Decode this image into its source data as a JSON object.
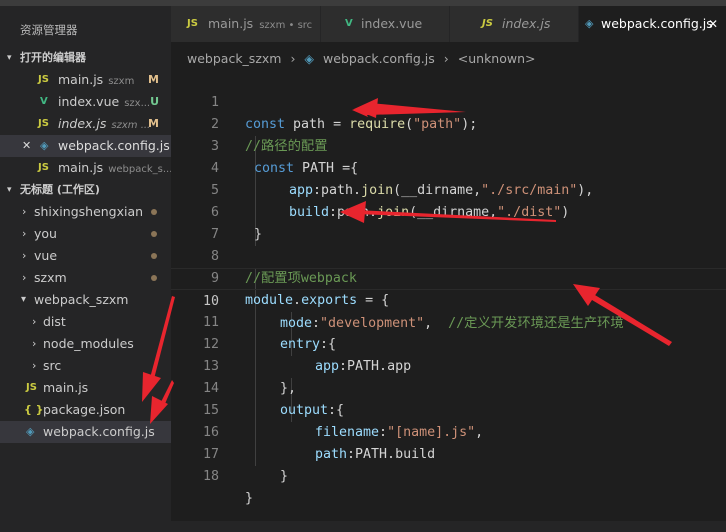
{
  "sidebar": {
    "title": "资源管理器",
    "open_editors": {
      "heading": "打开的编辑器",
      "items": [
        {
          "name": "main.js",
          "sub": "szxm",
          "status": "M",
          "type": "js"
        },
        {
          "name": "index.vue",
          "sub": "szx...",
          "status": "U",
          "type": "vue"
        },
        {
          "name": "index.js",
          "sub": "szxm ...",
          "status": "M",
          "type": "js"
        },
        {
          "name": "webpack.config.js ...",
          "sub": "",
          "status": "",
          "type": "cfg",
          "close": "✕"
        },
        {
          "name": "main.js",
          "sub": "webpack_s...",
          "status": "",
          "type": "js"
        }
      ]
    },
    "workspace": {
      "heading": "无标题 (工作区)",
      "items": [
        {
          "name": "shixingshengxian",
          "dot": true
        },
        {
          "name": "you",
          "dot": true
        },
        {
          "name": "vue",
          "dot": true
        },
        {
          "name": "szxm",
          "dot": true
        },
        {
          "name": "webpack_szxm",
          "dot": false
        },
        {
          "name": "dist",
          "dot": false
        },
        {
          "name": "node_modules",
          "dot": false
        },
        {
          "name": "src",
          "dot": false
        },
        {
          "name": "main.js",
          "dot": false
        },
        {
          "name": "package.json",
          "dot": false
        },
        {
          "name": "webpack.config.js",
          "dot": false
        }
      ]
    }
  },
  "tabs": [
    {
      "name": "main.js",
      "sub": "szxm • src"
    },
    {
      "name": "index.vue",
      "sub": ""
    },
    {
      "name": "index.js",
      "sub": ""
    },
    {
      "name": "webpack.config.js",
      "sub": ""
    }
  ],
  "breadcrumb": [
    "webpack_szxm",
    "webpack.config.js",
    "<unknown>"
  ],
  "icons": {
    "js": "JS",
    "vue": "V",
    "json": "{ }",
    "cfg": "◈",
    "chevron_down": "▾",
    "chevron_right": "›",
    "close": "✕"
  },
  "code": {
    "current_line": 10,
    "lines": [
      {
        "n": "1"
      },
      {
        "n": "2"
      },
      {
        "n": "3"
      },
      {
        "n": "4"
      },
      {
        "n": "5"
      },
      {
        "n": "6"
      },
      {
        "n": "7"
      },
      {
        "n": "8"
      },
      {
        "n": "9"
      },
      {
        "n": "10"
      },
      {
        "n": "11"
      },
      {
        "n": "12"
      },
      {
        "n": "13"
      },
      {
        "n": "14"
      },
      {
        "n": "15"
      },
      {
        "n": "16"
      },
      {
        "n": "17"
      },
      {
        "n": "18"
      }
    ],
    "tokens": {
      "l1": [
        "const",
        " path = ",
        "require",
        "(",
        "\"path\"",
        ");"
      ],
      "l2": "//路径的配置",
      "l3": [
        "const",
        " PATH ={"
      ],
      "l4": [
        "app",
        ":path.",
        "join",
        "(__dirname,",
        "\"./src/main\"",
        "),"
      ],
      "l5": [
        "build",
        ":path.",
        "join",
        "(__dirname,",
        "\"./dist\"",
        ")"
      ],
      "l6": "}",
      "l8": "//配置项webpack",
      "l9": [
        "module",
        ".",
        "exports",
        " = {"
      ],
      "l10": [
        "mode",
        ":",
        "\"development\"",
        ",  ",
        "//定义开发环境还是生产环境"
      ],
      "l11": [
        "entry",
        ":{"
      ],
      "l12": [
        "app",
        ":PATH.app"
      ],
      "l13": "},",
      "l14": [
        "output",
        ":{"
      ],
      "l15": [
        "filename",
        ":",
        "\"[name].js\"",
        ","
      ],
      "l16": [
        "path",
        ":PATH.build"
      ],
      "l17": "}",
      "l18": "}"
    }
  },
  "colors": {
    "editor_bg": "#1e1e1e",
    "sidebar_bg": "#252526",
    "arrow": "#e8252e"
  }
}
